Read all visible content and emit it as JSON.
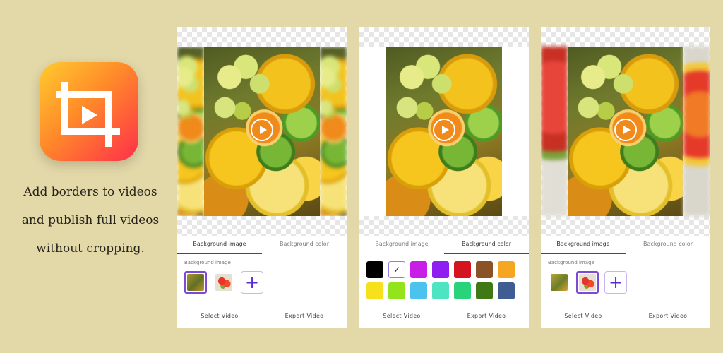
{
  "tagline": {
    "line1": "Add borders to videos",
    "line2": "and publish full videos",
    "line3": "without cropping."
  },
  "colors": {
    "background": "#e3d8a8",
    "accent": "#5b2bd6",
    "icon_gradient": [
      "#ffcc2e",
      "#ff8a2a",
      "#ff2e4a"
    ]
  },
  "screens": [
    {
      "tabs": [
        {
          "label": "Background image",
          "active": true
        },
        {
          "label": "Background color",
          "active": false
        }
      ],
      "section_label": "Background image",
      "footer": {
        "select": "Select Video",
        "export": "Export Video"
      }
    },
    {
      "tabs": [
        {
          "label": "Background image",
          "active": false
        },
        {
          "label": "Background color",
          "active": true
        }
      ],
      "swatches": [
        "#000000",
        "#ffffff",
        "#c81ee6",
        "#8f1ef0",
        "#d4141f",
        "#8b5225",
        "#f5a623",
        "#f7e11c",
        "#93e41a",
        "#4cc3ef",
        "#4de4c2",
        "#29d37a",
        "#3f7814",
        "#3f5d93"
      ],
      "selected_swatch": "#ffffff",
      "footer": {
        "select": "Select Video",
        "export": "Export Video"
      }
    },
    {
      "tabs": [
        {
          "label": "Background image",
          "active": true
        },
        {
          "label": "Background color",
          "active": false
        }
      ],
      "section_label": "Background image",
      "footer": {
        "select": "Select Video",
        "export": "Export Video"
      }
    }
  ]
}
